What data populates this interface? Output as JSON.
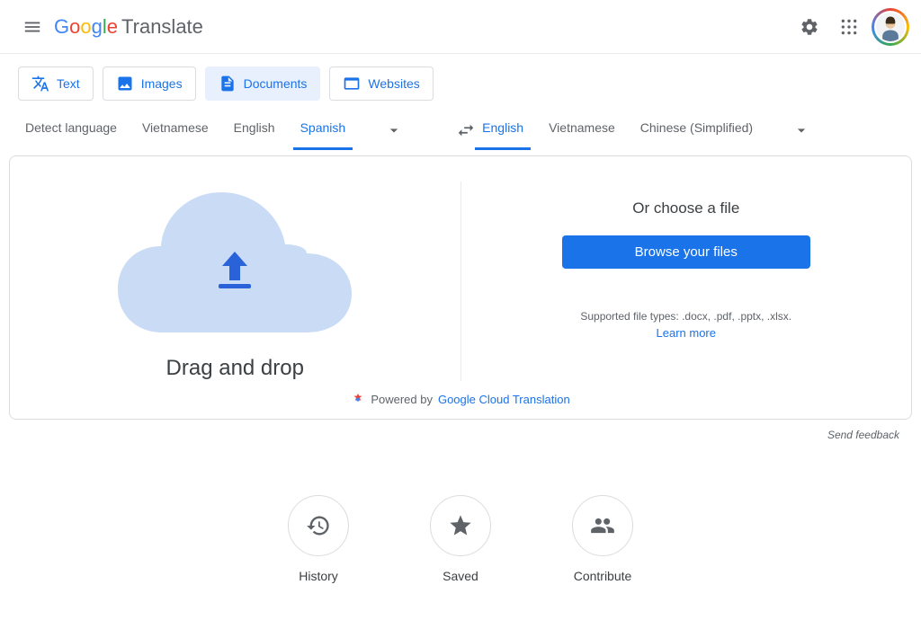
{
  "header": {
    "product": "Translate"
  },
  "modes": {
    "text": "Text",
    "images": "Images",
    "documents": "Documents",
    "websites": "Websites"
  },
  "source_langs": {
    "detect": "Detect language",
    "l1": "Vietnamese",
    "l2": "English",
    "l3": "Spanish"
  },
  "target_langs": {
    "l1": "English",
    "l2": "Vietnamese",
    "l3": "Chinese (Simplified)"
  },
  "panel": {
    "drag": "Drag and drop",
    "choose": "Or choose a file",
    "browse": "Browse your files",
    "supported": "Supported file types: .docx, .pdf, .pptx, .xlsx.",
    "learn": "Learn more",
    "powered_prefix": "Powered by",
    "powered_link": "Google Cloud Translation"
  },
  "feedback": "Send feedback",
  "bottom": {
    "history": "History",
    "saved": "Saved",
    "contribute": "Contribute"
  }
}
